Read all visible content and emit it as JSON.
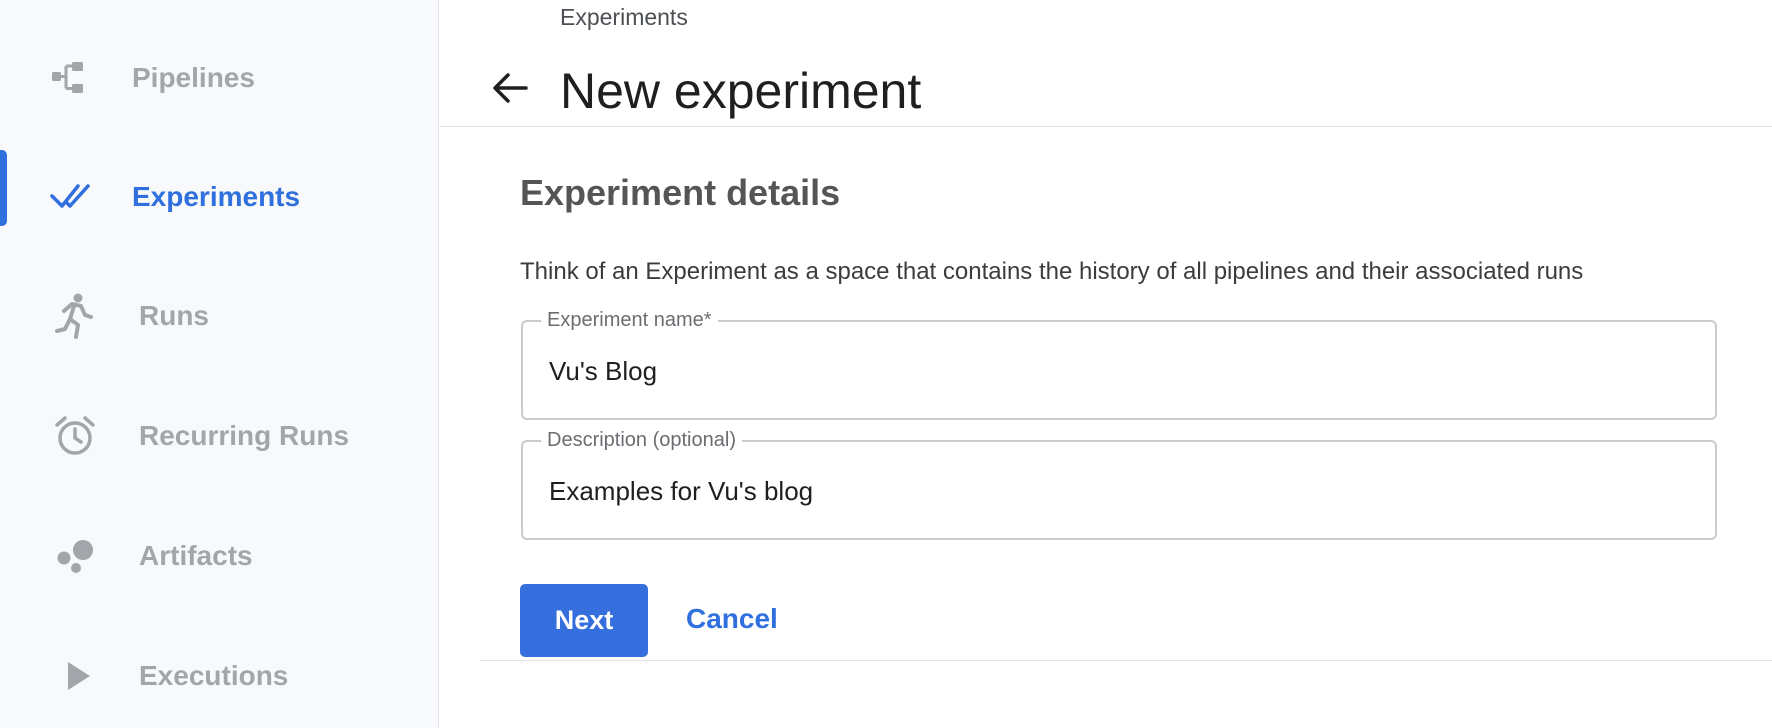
{
  "sidebar": {
    "items": [
      {
        "label": "Pipelines",
        "icon": "pipeline-icon",
        "active": false
      },
      {
        "label": "Experiments",
        "icon": "double-check-icon",
        "active": true
      },
      {
        "label": "Runs",
        "icon": "runner-icon",
        "active": false
      },
      {
        "label": "Recurring Runs",
        "icon": "alarm-clock-icon",
        "active": false
      },
      {
        "label": "Artifacts",
        "icon": "bubbles-icon",
        "active": false
      },
      {
        "label": "Executions",
        "icon": "play-icon",
        "active": false
      }
    ]
  },
  "header": {
    "breadcrumb": "Experiments",
    "title": "New experiment",
    "back_icon": "arrow-left-icon"
  },
  "form": {
    "section_title": "Experiment details",
    "description": "Think of an Experiment as a space that contains the history of all pipelines and their associated runs",
    "name_field": {
      "label": "Experiment name*",
      "value": "Vu's Blog"
    },
    "description_field": {
      "label": "Description (optional)",
      "value": "Examples for Vu's blog"
    },
    "next_label": "Next",
    "cancel_label": "Cancel"
  },
  "colors": {
    "accent": "#2f6fde",
    "button": "#356fdd",
    "inactive_nav": "#a2a6ab",
    "sidebar_bg": "#f8f9fb"
  }
}
